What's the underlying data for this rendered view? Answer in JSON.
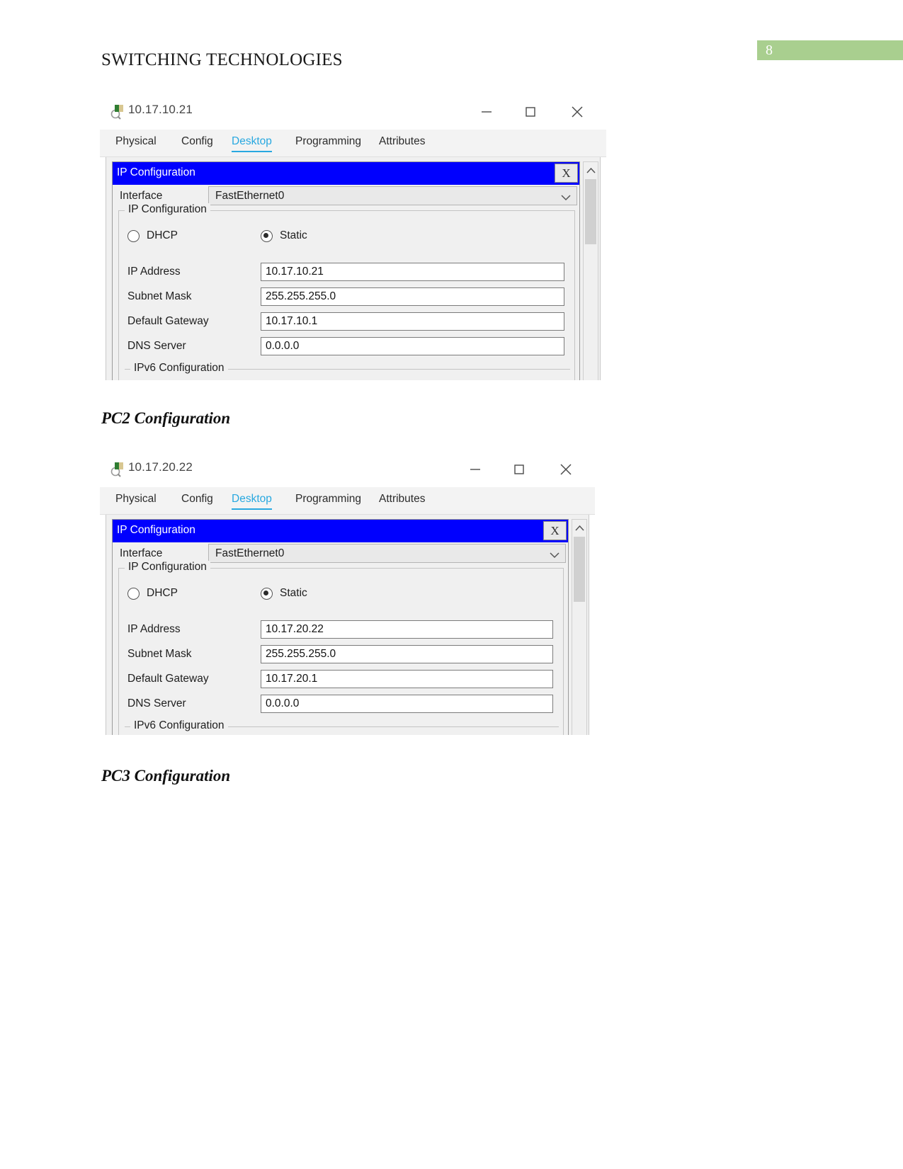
{
  "document": {
    "title": "SWITCHING TECHNOLOGIES",
    "page_number": "8",
    "page_band_color": "#a9cf8f",
    "headings": {
      "pc2": "PC2 Configuration",
      "pc3": "PC3 Configuration"
    }
  },
  "windows": [
    {
      "id": "pc1",
      "title": "10.17.10.21",
      "icon": "packet-tracer-pc-icon",
      "controls": {
        "minimize": "minimize-icon",
        "maximize": "maximize-icon",
        "close": "close-icon"
      },
      "tabs": [
        {
          "label": "Physical",
          "active": false
        },
        {
          "label": "Config",
          "active": false
        },
        {
          "label": "Desktop",
          "active": true
        },
        {
          "label": "Programming",
          "active": false
        },
        {
          "label": "Attributes",
          "active": false
        }
      ],
      "dialog": {
        "title": "IP Configuration",
        "close_label": "X",
        "titlebar_color": "#0000fe",
        "interface_label": "Interface",
        "interface_value": "FastEthernet0",
        "group_legend": "IP Configuration",
        "radios": [
          {
            "label": "DHCP",
            "checked": false
          },
          {
            "label": "Static",
            "checked": true
          }
        ],
        "fields": [
          {
            "label": "IP Address",
            "value": "10.17.10.21"
          },
          {
            "label": "Subnet Mask",
            "value": "255.255.255.0"
          },
          {
            "label": "Default Gateway",
            "value": "10.17.10.1"
          },
          {
            "label": "DNS Server",
            "value": "0.0.0.0"
          }
        ],
        "ipv6_legend": "IPv6 Configuration"
      }
    },
    {
      "id": "pc2",
      "title": "10.17.20.22",
      "icon": "packet-tracer-pc-icon",
      "controls": {
        "minimize": "minimize-icon",
        "maximize": "maximize-icon",
        "close": "close-icon"
      },
      "tabs": [
        {
          "label": "Physical",
          "active": false
        },
        {
          "label": "Config",
          "active": false
        },
        {
          "label": "Desktop",
          "active": true
        },
        {
          "label": "Programming",
          "active": false
        },
        {
          "label": "Attributes",
          "active": false
        }
      ],
      "dialog": {
        "title": "IP Configuration",
        "close_label": "X",
        "titlebar_color": "#0000fe",
        "interface_label": "Interface",
        "interface_value": "FastEthernet0",
        "group_legend": "IP Configuration",
        "radios": [
          {
            "label": "DHCP",
            "checked": false
          },
          {
            "label": "Static",
            "checked": true
          }
        ],
        "fields": [
          {
            "label": "IP Address",
            "value": "10.17.20.22"
          },
          {
            "label": "Subnet Mask",
            "value": "255.255.255.0"
          },
          {
            "label": "Default Gateway",
            "value": "10.17.20.1"
          },
          {
            "label": "DNS Server",
            "value": "0.0.0.0"
          }
        ],
        "ipv6_legend": "IPv6 Configuration"
      }
    }
  ]
}
